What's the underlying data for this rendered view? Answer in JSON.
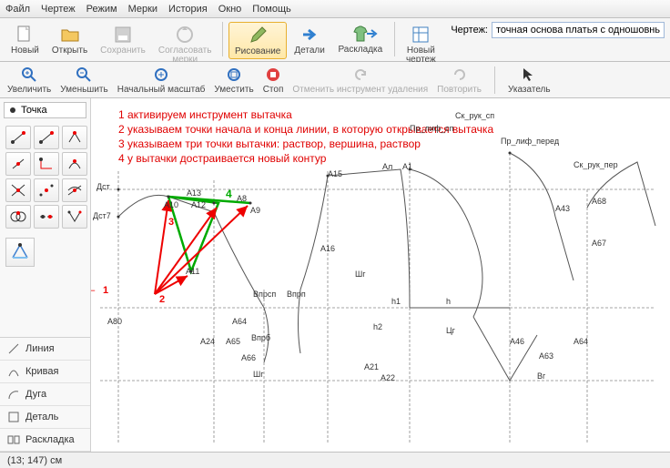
{
  "menu": {
    "file": "Файл",
    "drawing": "Чертеж",
    "mode": "Режим",
    "measures": "Мерки",
    "history": "История",
    "window": "Окно",
    "help": "Помощь"
  },
  "toolbar": {
    "new": "Новый",
    "open": "Открыть",
    "save": "Сохранить",
    "sync": "Согласовать\nмерки",
    "draw": "Рисование",
    "details": "Детали",
    "layout": "Раскладка",
    "newdraw": "Новый чертеж",
    "drawing_label": "Чертеж:",
    "drawing_value": "точная основа платья с одношовным рука"
  },
  "toolbar2": {
    "zoomin": "Увеличить",
    "zoomout": "Уменьшить",
    "zoomfit": "Начальный масштаб",
    "fit": "Уместить",
    "stop": "Стоп",
    "undo": "Отменить инструмент удаления",
    "redo": "Повторить",
    "pointer": "Указатель"
  },
  "left": {
    "tab": "Точка",
    "cats": {
      "line": "Линия",
      "curve": "Кривая",
      "arc": "Дуга",
      "detail": "Деталь",
      "layout": "Раскладка"
    }
  },
  "instructions": {
    "l1": "1 активируем инструмент вытачка",
    "l2": "2 указываем точки начала и конца линии, в которую открывается вытачка",
    "l3": "3 указываем три точки вытачки: раствор, вершина, раствор",
    "l4": "4 у вытачки достраивается новый контур"
  },
  "markers": {
    "m1": "1",
    "m2": "2",
    "m3": "3",
    "m4": "4"
  },
  "labels": {
    "Dst": "Дст",
    "Dst7": "Дст7",
    "A80": "А80",
    "A24": "А24",
    "A65": "А65",
    "A13": "А13",
    "A12": "А12",
    "A10": "А10",
    "A11": "А11",
    "A8": "А8",
    "A9": "А9",
    "Vprsn": "Впрсп",
    "A64": "А64",
    "Vprb": "Впрб",
    "A66": "А66",
    "Shg": "Шг",
    "Vprn": "Впрп",
    "A15": "А15",
    "A16": "А16",
    "Shg2": "Шг",
    "A1": "А1",
    "Al": "Ал",
    "A21": "А21",
    "A22": "А22",
    "h1": "h1",
    "h2": "h2",
    "h": "h",
    "Pr_lif_sp": "Пр_лиф_сп",
    "Sk_ruk_sp": "Ск_рук_сп",
    "Pr_lif_pered": "Пр_лиф_перед",
    "Sk_ruk_per": "Ск_рук_пер",
    "A43": "А43",
    "A68": "А68",
    "A67": "А67",
    "A46": "А46",
    "A63": "А63",
    "A64b": "А64",
    "Cg": "Цг",
    "Bg": "Вг"
  },
  "status": "(13; 147) см"
}
